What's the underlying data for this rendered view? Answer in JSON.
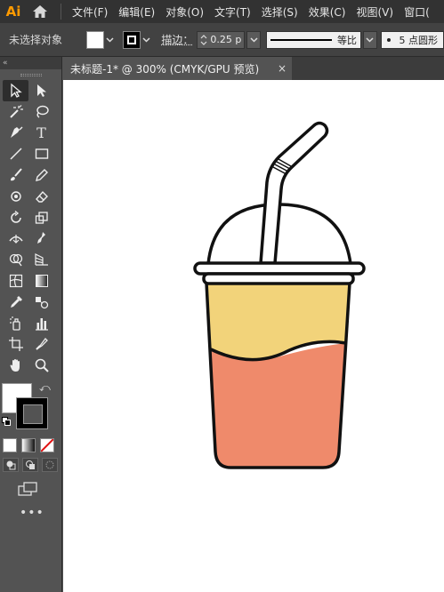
{
  "app": {
    "logo": "Ai"
  },
  "menu": {
    "items": [
      "文件(F)",
      "编辑(E)",
      "对象(O)",
      "文字(T)",
      "选择(S)",
      "效果(C)",
      "视图(V)",
      "窗口("
    ]
  },
  "control_bar": {
    "selection_status": "未选择对象",
    "stroke_label": "描边：",
    "stroke_value": "0.25 p",
    "profile_label": "等比",
    "brush_label": "5 点圆形"
  },
  "document": {
    "tab_title": "未标题-1* @ 300% (CMYK/GPU 预览)",
    "close_glyph": "×"
  },
  "toolbar": {
    "collapse_glyph": "«",
    "type_tool_glyph": "T",
    "more_glyph": "•••",
    "swap_glyph": "⤺"
  },
  "artwork": {
    "colors": {
      "outline": "#111111",
      "tea_top": "#f2d37a",
      "tea_bottom": "#ef8a6b",
      "lid": "#ffffff",
      "straw": "#ffffff"
    }
  }
}
